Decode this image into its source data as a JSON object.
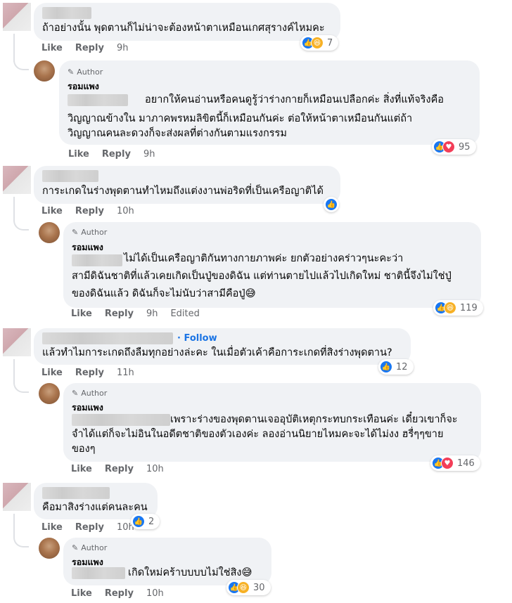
{
  "actions": {
    "like": "Like",
    "reply": "Reply",
    "edited": "Edited"
  },
  "author_badge": "Author",
  "author_name": "รอมแพง",
  "follow": "Follow",
  "icons": {
    "like": "like-reaction-icon",
    "love": "love-reaction-icon",
    "haha": "haha-reaction-icon",
    "pencil": "pencil-icon"
  },
  "colors": {
    "like": "#1877f2",
    "love": "#f33e58",
    "haha": "#f7b125",
    "link": "#1b74e4",
    "bubble": "#f0f2f5"
  },
  "comments": [
    {
      "text": [
        "ถ้าอย่างนั้น พุดตานก็ไม่น่าจะต้องหน้าตาเหมือนเกศสุรางค์ไหมคะ"
      ],
      "time": "9h",
      "reactions": {
        "types": [
          "like",
          "haha"
        ],
        "count": "7"
      },
      "reply": {
        "text": [
          "อยากให้คนอ่านหรือคนดูรู้ว่าร่างกายก็เหมือนเปลือกค่ะ สิ่งที่แท้จริงคือ",
          "วิญญาณข้างใน มาภาคพรหมลิขิตนี้ก็เหมือนกันค่ะ ต่อให้หน้าตาเหมือนกันแต่ถ้า",
          "วิญญาณคนละดวงก็จะส่งผลที่ต่างกันตามแรงกรรม"
        ],
        "time": "9h",
        "reactions": {
          "types": [
            "like",
            "love"
          ],
          "count": "95"
        }
      }
    },
    {
      "text": [
        "การะเกดในร่างพุดตานทำไหมถึงแต่งงานพ่อริดที่เป็นเครือญาติได้"
      ],
      "time": "10h",
      "reactions": {
        "types": [
          "like"
        ],
        "count": ""
      },
      "reply": {
        "text": [
          "ไม่ได้เป็นเครือญาติกันทางกายภาพค่ะ ยกตัวอย่างคร่าวๆนะคะว่า",
          "สามีดิฉันชาติที่แล้วเคยเกิดเป็นปู่ของดิฉัน แต่ท่านตายไปแล้วไปเกิดใหม่ ชาตินี้จึงไม่ใช่ปู่",
          "ของดิฉันแล้ว ดิฉันก็จะไม่นับว่าสามีคือปู่😅"
        ],
        "time": "9h",
        "edited": true,
        "reactions": {
          "types": [
            "like",
            "haha"
          ],
          "count": "119"
        }
      }
    },
    {
      "text": [
        "แล้วทำไมการะเกดถึงลืมทุกอย่างล่ะคะ ในเมื่อตัวเค้าคือการะเกดที่สิงร่างพุดตาน?"
      ],
      "time": "11h",
      "reactions": {
        "types": [
          "like"
        ],
        "count": "12"
      },
      "reply": {
        "text": [
          "เพราะร่างของพุดตานเจออุบัติเหตุกระทบกระเทือนค่ะ เดี๋ยวเขาก็จะ",
          "จำได้แต่ก็จะไม่อินในอดีตชาติของตัวเองค่ะ ลองอ่านนิยายไหมคะจะได้ไม่งง ฮรื่ๆๆขาย",
          "ของๆ"
        ],
        "time": "10h",
        "reactions": {
          "types": [
            "like",
            "love"
          ],
          "count": "146"
        }
      }
    },
    {
      "text": [
        "คือมาสิงร่างแต่คนละคน"
      ],
      "time": "10h",
      "reactions": {
        "types": [
          "like"
        ],
        "count": "2"
      },
      "reply": {
        "text": [
          "เกิดใหม่คร้าบบบบไม่ใช่สิง😅"
        ],
        "time": "10h",
        "reactions": {
          "types": [
            "like",
            "haha"
          ],
          "count": "30"
        }
      }
    }
  ]
}
